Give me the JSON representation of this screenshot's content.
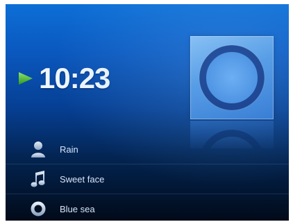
{
  "player": {
    "time": "10:23",
    "colors": {
      "accent_play": "#3fb62e",
      "time_text": "#eef6ff",
      "icon_tint": "#b9cde6"
    }
  },
  "cover_art": {
    "icon": "ring-logo-icon"
  },
  "tracks": [
    {
      "label": "Rain",
      "icon": "person-icon"
    },
    {
      "label": "Sweet face",
      "icon": "music-note-icon"
    },
    {
      "label": "Blue sea",
      "icon": "ring-icon"
    }
  ]
}
